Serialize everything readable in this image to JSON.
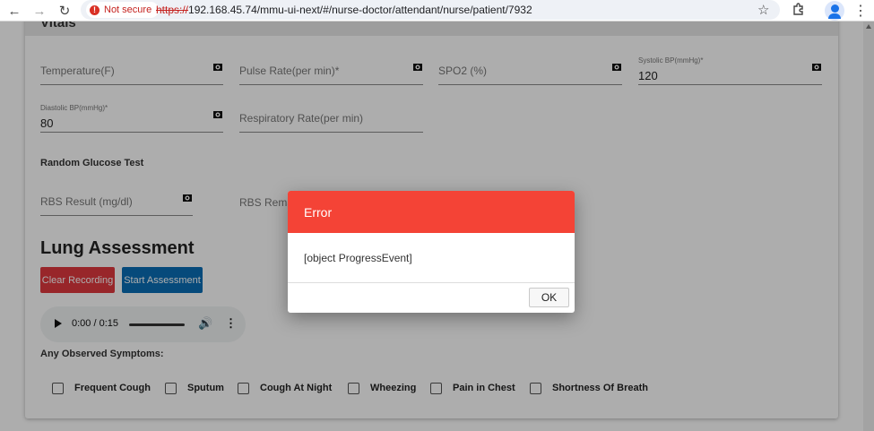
{
  "browser": {
    "security_label": "Not secure",
    "url_scheme": "https://",
    "url_rest": "192.168.45.74/mmu-ui-next/#/nurse-doctor/attendant/nurse/patient/7932",
    "icons": [
      "back-arrow-icon",
      "forward-arrow-icon",
      "reload-icon",
      "star-icon",
      "extensions-icon",
      "profile-icon",
      "menu-icon"
    ]
  },
  "vitals": {
    "title": "Vitals",
    "fields": {
      "temperature": {
        "label": "Temperature(F)",
        "value": ""
      },
      "pulse_rate": {
        "label": "Pulse Rate(per min)*",
        "value": ""
      },
      "spo2": {
        "label": "SPO2 (%)",
        "value": ""
      },
      "systolic": {
        "label": "Systolic BP(mmHg)*",
        "value": "120"
      },
      "diastolic": {
        "label": "Diastolic BP(mmHg)*",
        "value": "80"
      },
      "respiratory_rate": {
        "label": "Respiratory Rate(per min)",
        "value": ""
      }
    }
  },
  "glucose": {
    "title": "Random Glucose Test",
    "rbs_result_label": "RBS Result (mg/dl)",
    "rbs_remarks_label": "RBS Rema"
  },
  "lung": {
    "title": "Lung Assessment",
    "clear_button": "Clear Recording",
    "start_button": "Start Assessment",
    "audio_time": "0:00 / 0:15"
  },
  "symptoms": {
    "title": "Any Observed Symptoms:",
    "items": [
      "Frequent Cough",
      "Sputum",
      "Cough At Night",
      "Wheezing",
      "Pain in Chest",
      "Shortness Of Breath"
    ]
  },
  "dialog": {
    "title": "Error",
    "message": "[object ProgressEvent]",
    "ok_label": "OK"
  },
  "colors": {
    "dialog_header": "#f44336",
    "clear_button": "#e0383e",
    "start_button": "#0a6eb5",
    "not_secure": "#c5221f"
  }
}
